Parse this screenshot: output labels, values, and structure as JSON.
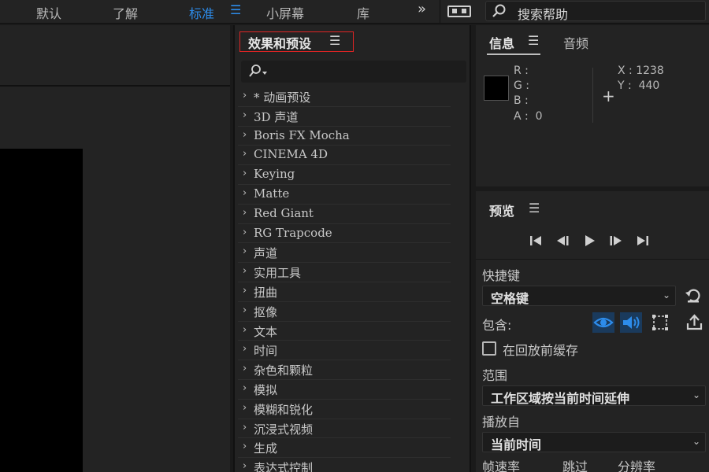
{
  "workspaces": {
    "items": [
      "默认",
      "了解",
      "标准",
      "小屏幕",
      "库"
    ],
    "active_index": 2,
    "menu_icon": "hamburger-menu-icon",
    "overflow_icon": "chevron-double-right-icon"
  },
  "help": {
    "placeholder": "搜索帮助"
  },
  "effects_panel": {
    "title": "效果和预设",
    "menu_icon": "hamburger-menu-icon",
    "search_icon": "search-dropdown-icon",
    "items": [
      "* 动画预设",
      "3D 声道",
      "Boris FX Mocha",
      "CINEMA 4D",
      "Keying",
      "Matte",
      "Red Giant",
      "RG Trapcode",
      "声道",
      "实用工具",
      "扭曲",
      "抠像",
      "文本",
      "时间",
      "杂色和颗粒",
      "模拟",
      "模糊和锐化",
      "沉浸式视频",
      "生成",
      "表达式控制"
    ]
  },
  "info_panel": {
    "tabs": [
      "信息",
      "音频"
    ],
    "r_label": "R :",
    "g_label": "G :",
    "b_label": "B :",
    "a_label": "A :  0",
    "x_label": "X : 1238",
    "y_label": "Y :  440",
    "swatch_color": "#000000"
  },
  "preview_panel": {
    "title": "预览",
    "shortcut_label": "快捷键",
    "shortcut_value": "空格键",
    "include_label": "包含:",
    "cache_label": "在回放前缓存",
    "range_label": "范围",
    "range_value": "工作区域按当前时间延伸",
    "play_from_label": "播放自",
    "play_from_value": "当前时间",
    "bottom_labels": [
      "帧速率",
      "跳过",
      "分辨率"
    ],
    "accent_color": "#2d8ceb"
  }
}
